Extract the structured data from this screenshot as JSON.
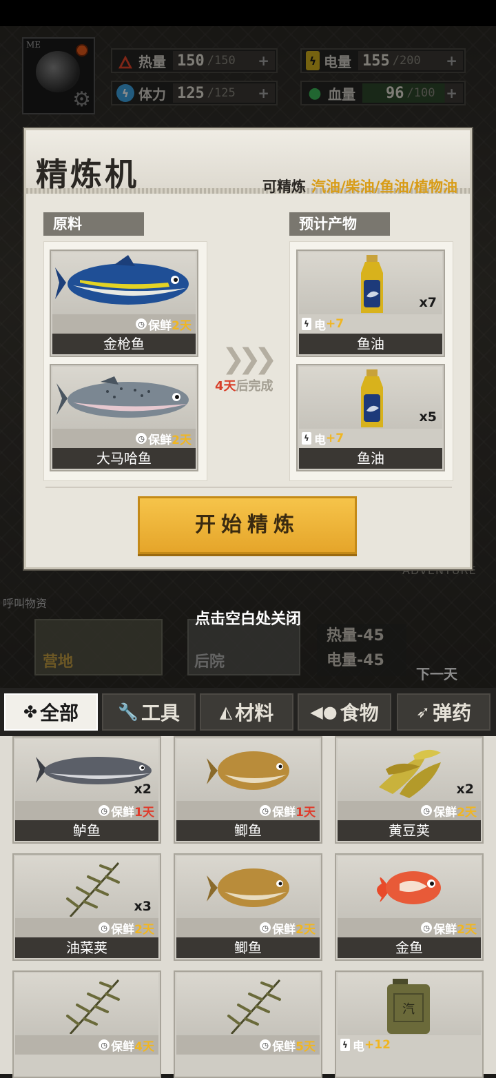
{
  "stats": {
    "heat": {
      "label": "热量",
      "value": "150",
      "max": "/150"
    },
    "power": {
      "label": "电量",
      "value": "155",
      "max": "/200"
    },
    "stamina": {
      "label": "体力",
      "value": "125",
      "max": "/125"
    },
    "blood": {
      "label": "血量",
      "value": "96",
      "max": "/100"
    },
    "plus": "+"
  },
  "avatar": {
    "tag": "ME"
  },
  "refiner": {
    "title": "精炼机",
    "refinable_label": "可精炼",
    "refinable_value": "汽油/柴油/鱼油/植物油",
    "input_section": "原料",
    "output_section": "预计产物",
    "time_days": "4天",
    "time_suffix": "后完成",
    "start_label": "开始精炼",
    "inputs": [
      {
        "name": "金枪鱼",
        "fresh_label": "保鲜",
        "fresh_value": "2天",
        "icon": "tuna-icon"
      },
      {
        "name": "大马哈鱼",
        "fresh_label": "保鲜",
        "fresh_value": "2天",
        "icon": "salmon-icon"
      }
    ],
    "outputs": [
      {
        "name": "鱼油",
        "elec_label": "电",
        "elec_value": "+7",
        "count": "x7",
        "icon": "fish-oil-bottle-icon"
      },
      {
        "name": "鱼油",
        "elec_label": "电",
        "elec_value": "+7",
        "count": "x5",
        "icon": "fish-oil-bottle-icon"
      }
    ]
  },
  "close_hint": "点击空白处关闭",
  "scene": {
    "call_supplies": "呼叫物资",
    "adventure": "ADVENTURE",
    "camp": "营地",
    "backyard": "后院",
    "cost_heat": "热量-45",
    "cost_power": "电量-45",
    "next_day": "下一天"
  },
  "tabs": [
    {
      "label": "全部",
      "icon": "grid-icon",
      "active": true
    },
    {
      "label": "工具",
      "icon": "wrench-icon",
      "active": false
    },
    {
      "label": "材料",
      "icon": "material-icon",
      "active": false
    },
    {
      "label": "食物",
      "icon": "food-icon",
      "active": false
    },
    {
      "label": "弹药",
      "icon": "bullet-icon",
      "active": false
    }
  ],
  "inventory": [
    {
      "name": "鲈鱼",
      "fresh_label": "保鲜",
      "fresh_value": "1天",
      "count": "x2",
      "icon": "bass-icon"
    },
    {
      "name": "鲫鱼",
      "fresh_label": "保鲜",
      "fresh_value": "1天",
      "count": "",
      "icon": "crucian-carp-icon"
    },
    {
      "name": "黄豆荚",
      "fresh_label": "保鲜",
      "fresh_value": "2天",
      "count": "x2",
      "icon": "soybean-pod-icon"
    },
    {
      "name": "油菜荚",
      "fresh_label": "保鲜",
      "fresh_value": "2天",
      "count": "x3",
      "icon": "rapeseed-pod-icon"
    },
    {
      "name": "鲫鱼",
      "fresh_label": "保鲜",
      "fresh_value": "2天",
      "count": "",
      "icon": "crucian-carp-icon"
    },
    {
      "name": "金鱼",
      "fresh_label": "保鲜",
      "fresh_value": "2天",
      "count": "",
      "icon": "goldfish-icon"
    },
    {
      "name": "",
      "fresh_label": "保鲜",
      "fresh_value": "4天",
      "count": "",
      "icon": "rapeseed-pod-icon"
    },
    {
      "name": "",
      "fresh_label": "保鲜",
      "fresh_value": "5天",
      "count": "",
      "icon": "rapeseed-pod-icon"
    },
    {
      "name": "",
      "elec_label": "电",
      "elec_value": "+12",
      "count": "",
      "icon": "jerrycan-icon",
      "jerrycan_text": "汽"
    }
  ]
}
